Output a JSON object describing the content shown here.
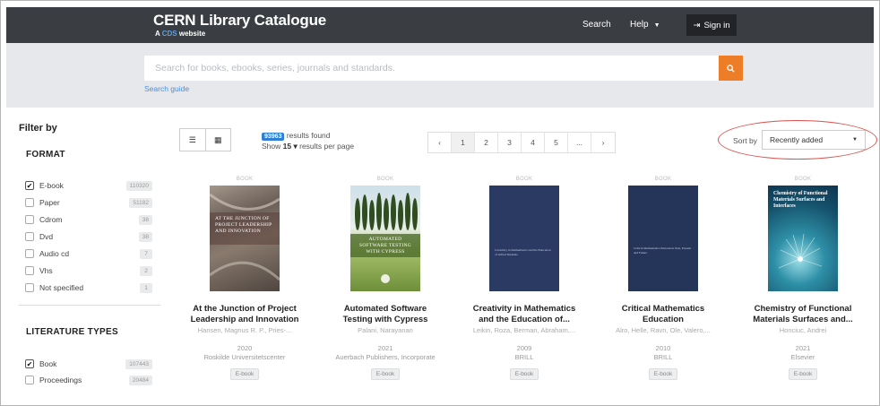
{
  "header": {
    "title": "CERN Library Catalogue",
    "subtitle_prefix": "A",
    "subtitle_link": "CDS",
    "subtitle_suffix": "website",
    "nav_search": "Search",
    "nav_help": "Help",
    "sign_in": "Sign in"
  },
  "search": {
    "placeholder": "Search for books, ebooks, series, journals and standards.",
    "guide": "Search guide"
  },
  "sidebar": {
    "filter_by": "Filter by",
    "format_title": "FORMAT",
    "format_items": [
      {
        "label": "E-book",
        "count": "110320",
        "checked": true
      },
      {
        "label": "Paper",
        "count": "51182",
        "checked": false
      },
      {
        "label": "Cdrom",
        "count": "38",
        "checked": false
      },
      {
        "label": "Dvd",
        "count": "38",
        "checked": false
      },
      {
        "label": "Audio cd",
        "count": "7",
        "checked": false
      },
      {
        "label": "Vhs",
        "count": "2",
        "checked": false
      },
      {
        "label": "Not specified",
        "count": "1",
        "checked": false
      }
    ],
    "literature_title": "LITERATURE TYPES",
    "literature_items": [
      {
        "label": "Book",
        "count": "107443",
        "checked": true
      },
      {
        "label": "Proceedings",
        "count": "20484",
        "checked": false
      }
    ]
  },
  "toolbar": {
    "results_count": "93963",
    "results_text": "results found",
    "show_prefix": "Show",
    "per_page": "15",
    "show_suffix": "results per page",
    "pages": [
      "‹",
      "1",
      "2",
      "3",
      "4",
      "5",
      "...",
      "›"
    ],
    "active_page": "1",
    "sort_label": "Sort by",
    "sort_value": "Recently added"
  },
  "books": [
    {
      "kind": "BOOK",
      "title_line1": "At the Junction of Project",
      "title_line2": "Leadership and Innovation",
      "authors": "Hansen, Magnus R. P., Pries-...",
      "year": "2020",
      "publisher": "Roskilde Universitetscenter",
      "format": "E-book",
      "cover_text": "AT THE JUNCTION OF PROJECT LEADERSHIP AND INNOVATION"
    },
    {
      "kind": "BOOK",
      "title_line1": "Automated Software",
      "title_line2": "Testing with Cypress",
      "authors": "Palani, Narayanan",
      "year": "2021",
      "publisher": "Auerbach Publishers, Incorporate",
      "format": "E-book",
      "cover_text": "AUTOMATED SOFTWARE TESTING WITH CYPRESS"
    },
    {
      "kind": "BOOK",
      "title_line1": "Creativity in Mathematics",
      "title_line2": "and the Education of...",
      "authors": "Leikin, Roza, Berman, Abraham,...",
      "year": "2009",
      "publisher": "BRILL",
      "format": "E-book",
      "cover_text": "Creativity in Mathematics and the Education of Gifted Students"
    },
    {
      "kind": "BOOK",
      "title_line1": "Critical Mathematics",
      "title_line2": "Education",
      "authors": "Alro, Helle, Ravn, Ole, Valero,...",
      "year": "2010",
      "publisher": "BRILL",
      "format": "E-book",
      "cover_text": "Critical Mathematics Education: Past, Present and Future"
    },
    {
      "kind": "BOOK",
      "title_line1": "Chemistry of Functional",
      "title_line2": "Materials Surfaces and...",
      "authors": "Honciuc, Andrei",
      "year": "2021",
      "publisher": "Elsevier",
      "format": "E-book",
      "cover_text": "Chemistry of Functional Materials Surfaces and Interfaces"
    }
  ],
  "colors": {
    "header_bg": "#3a3d42",
    "search_band": "#e6e8ec",
    "accent_orange": "#ee7d27",
    "link_blue": "#4a8fd9",
    "highlight_ring": "#d9534f"
  }
}
